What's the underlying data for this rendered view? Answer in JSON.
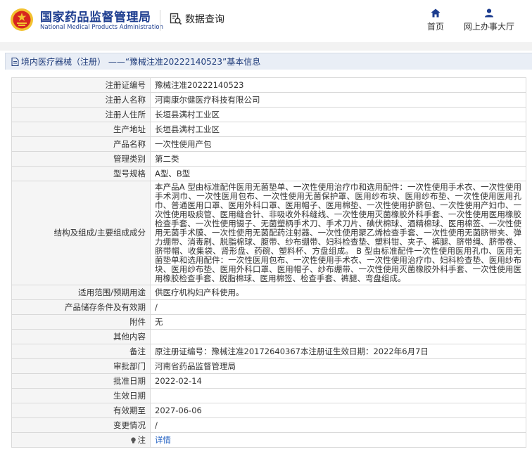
{
  "header": {
    "brand_cn": "国家药品监督管理局",
    "brand_en": "National Medical Products Administration",
    "data_query": "数据查询",
    "nav": {
      "home": "首页",
      "office": "网上办事大厅"
    }
  },
  "title_bar": {
    "text": "境内医疗器械（注册） ——“豫械注准20222140523”基本信息"
  },
  "rows": [
    {
      "label": "注册证编号",
      "value": "豫械注准20222140523"
    },
    {
      "label": "注册人名称",
      "value": "河南康尔健医疗科技有限公司"
    },
    {
      "label": "注册人住所",
      "value": "长垣县满村工业区"
    },
    {
      "label": "生产地址",
      "value": "长垣县满村工业区"
    },
    {
      "label": "产品名称",
      "value": "一次性使用产包"
    },
    {
      "label": "管理类别",
      "value": "第二类"
    },
    {
      "label": "型号规格",
      "value": "A型、B型"
    },
    {
      "label": "结构及组成/主要组成成分",
      "value": "本产品A 型由标准配件医用无菌垫单、一次性使用治疗巾和选用配件：一次性使用手术衣、一次性使用手术洞巾、一次性医用包布、一次性使用无菌保护罩、医用纱布块、医用纱布垫、一次性使用医用孔巾、普通医用口罩、医用外科口罩、医用帽子、医用棉垫、一次性使用护脐包、一次性使用产妇巾、一次性使用吸痰管、医用缝合针、非吸收外科缝线、一次性使用灭菌橡胶外科手套、一次性使用医用橡胶检查手套、一次性使用镊子、无菌塑柄手术刀、手术刀片、碘伏棉球、酒精棉球、医用棉签、一次性使用无菌手术膜、一次性使用无菌配药注射器、一次性使用聚乙烯检查手套、一次性使用无菌脐带夹、弹力绷带、消毒刷、脱脂棉球、腹带、纱布绷带、妇科检查垫、塑料钳、夹子、裤腿、脐带绳、脐带卷、脐带帽、收集袋、肾形盘、药碗、塑料杯、方盘组成。 B 型由标准配件一次性使用医用孔巾、医用无菌垫单和选用配件：一次性医用包布、一次性使用手术衣、一次性使用治疗巾、妇科检查垫、医用纱布块、医用纱布垫、医用外科口罩、医用帽子、纱布绷带、一次性使用灭菌橡胶外科手套、一次性使用医用橡胶检查手套、脱脂棉球、医用棉签、检查手套、裤腿、弯盘组成。"
    },
    {
      "label": "适用范围/预期用途",
      "value": "供医疗机构妇产科使用。"
    },
    {
      "label": "产品储存条件及有效期",
      "value": "/"
    },
    {
      "label": "附件",
      "value": "无"
    },
    {
      "label": "其他内容",
      "value": ""
    },
    {
      "label": "备注",
      "value": "原注册证编号：豫械注准20172640367本注册证生效日期：2022年6月7日"
    },
    {
      "label": "审批部门",
      "value": "河南省药品监督管理局"
    },
    {
      "label": "批准日期",
      "value": "2022-02-14"
    },
    {
      "label": "生效日期",
      "value": ""
    },
    {
      "label": "有效期至",
      "value": "2027-06-06"
    },
    {
      "label": "变更情况",
      "value": "/"
    },
    {
      "label": "注",
      "value": "详情"
    }
  ],
  "colors": {
    "brand": "#1d3d8f",
    "title_bg": "#e9eef6",
    "label_bg": "#f5f5f5",
    "link": "#1f5fc2",
    "logo_red": "#d7261e",
    "logo_gold": "#f3c230"
  },
  "icons": [
    "emblem-logo",
    "search-document-icon",
    "home-icon",
    "user-icon",
    "document-icon",
    "lightbulb-icon"
  ]
}
